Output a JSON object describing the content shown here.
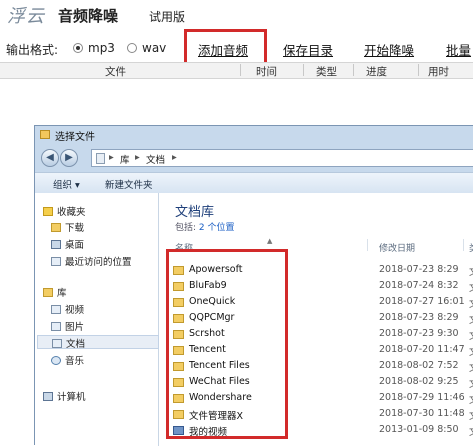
{
  "app": {
    "logo": "浮云",
    "name": "音频降噪",
    "edition": "试用版"
  },
  "toolbar": {
    "format_label": "输出格式:",
    "formats": [
      {
        "label": "mp3",
        "selected": true
      },
      {
        "label": "wav",
        "selected": false
      }
    ],
    "add_audio": "添加音频",
    "save_dir": "保存目录",
    "start_denoise": "开始降噪",
    "batch": "批量"
  },
  "columns": {
    "file": "文件",
    "time": "时间",
    "type": "类型",
    "progress": "进度",
    "elapsed": "用时"
  },
  "dialog": {
    "title": "选择文件",
    "breadcrumb": [
      "库",
      "文档"
    ],
    "organize": "组织 ▾",
    "new_folder": "新建文件夹",
    "nav": {
      "favorites": "收藏夹",
      "downloads": "下载",
      "desktop": "桌面",
      "recent": "最近访问的位置",
      "libraries": "库",
      "videos": "视频",
      "pictures": "图片",
      "documents": "文档",
      "music": "音乐",
      "computer": "计算机"
    },
    "library_title": "文档库",
    "library_includes_prefix": "包括: ",
    "library_includes_link": "2 个位置",
    "headers": {
      "name": "名称",
      "modified": "修改日期",
      "type": "类"
    },
    "files": [
      {
        "name": "Apowersoft",
        "date": "2018-07-23 8:29",
        "type": "文"
      },
      {
        "name": "BluFab9",
        "date": "2018-07-24 8:32",
        "type": "文"
      },
      {
        "name": "OneQuick",
        "date": "2018-07-27 16:01",
        "type": "文"
      },
      {
        "name": "QQPCMgr",
        "date": "2018-07-23 8:29",
        "type": "文"
      },
      {
        "name": "Scrshot",
        "date": "2018-07-23 9:30",
        "type": "文"
      },
      {
        "name": "Tencent",
        "date": "2018-07-20 11:47",
        "type": "文"
      },
      {
        "name": "Tencent Files",
        "date": "2018-08-02 7:52",
        "type": "文"
      },
      {
        "name": "WeChat Files",
        "date": "2018-08-02 9:25",
        "type": "文"
      },
      {
        "name": "Wondershare",
        "date": "2018-07-29 11:46",
        "type": "文"
      },
      {
        "name": "文件管理器X",
        "date": "2018-07-30 11:48",
        "type": "文"
      },
      {
        "name": "我的视频",
        "date": "2013-01-09 8:50",
        "type": "文"
      }
    ]
  },
  "colors": {
    "highlight_box": "#d22a2a",
    "dialog_frame": "#c7d9ec",
    "library_title": "#1e3f7a"
  }
}
